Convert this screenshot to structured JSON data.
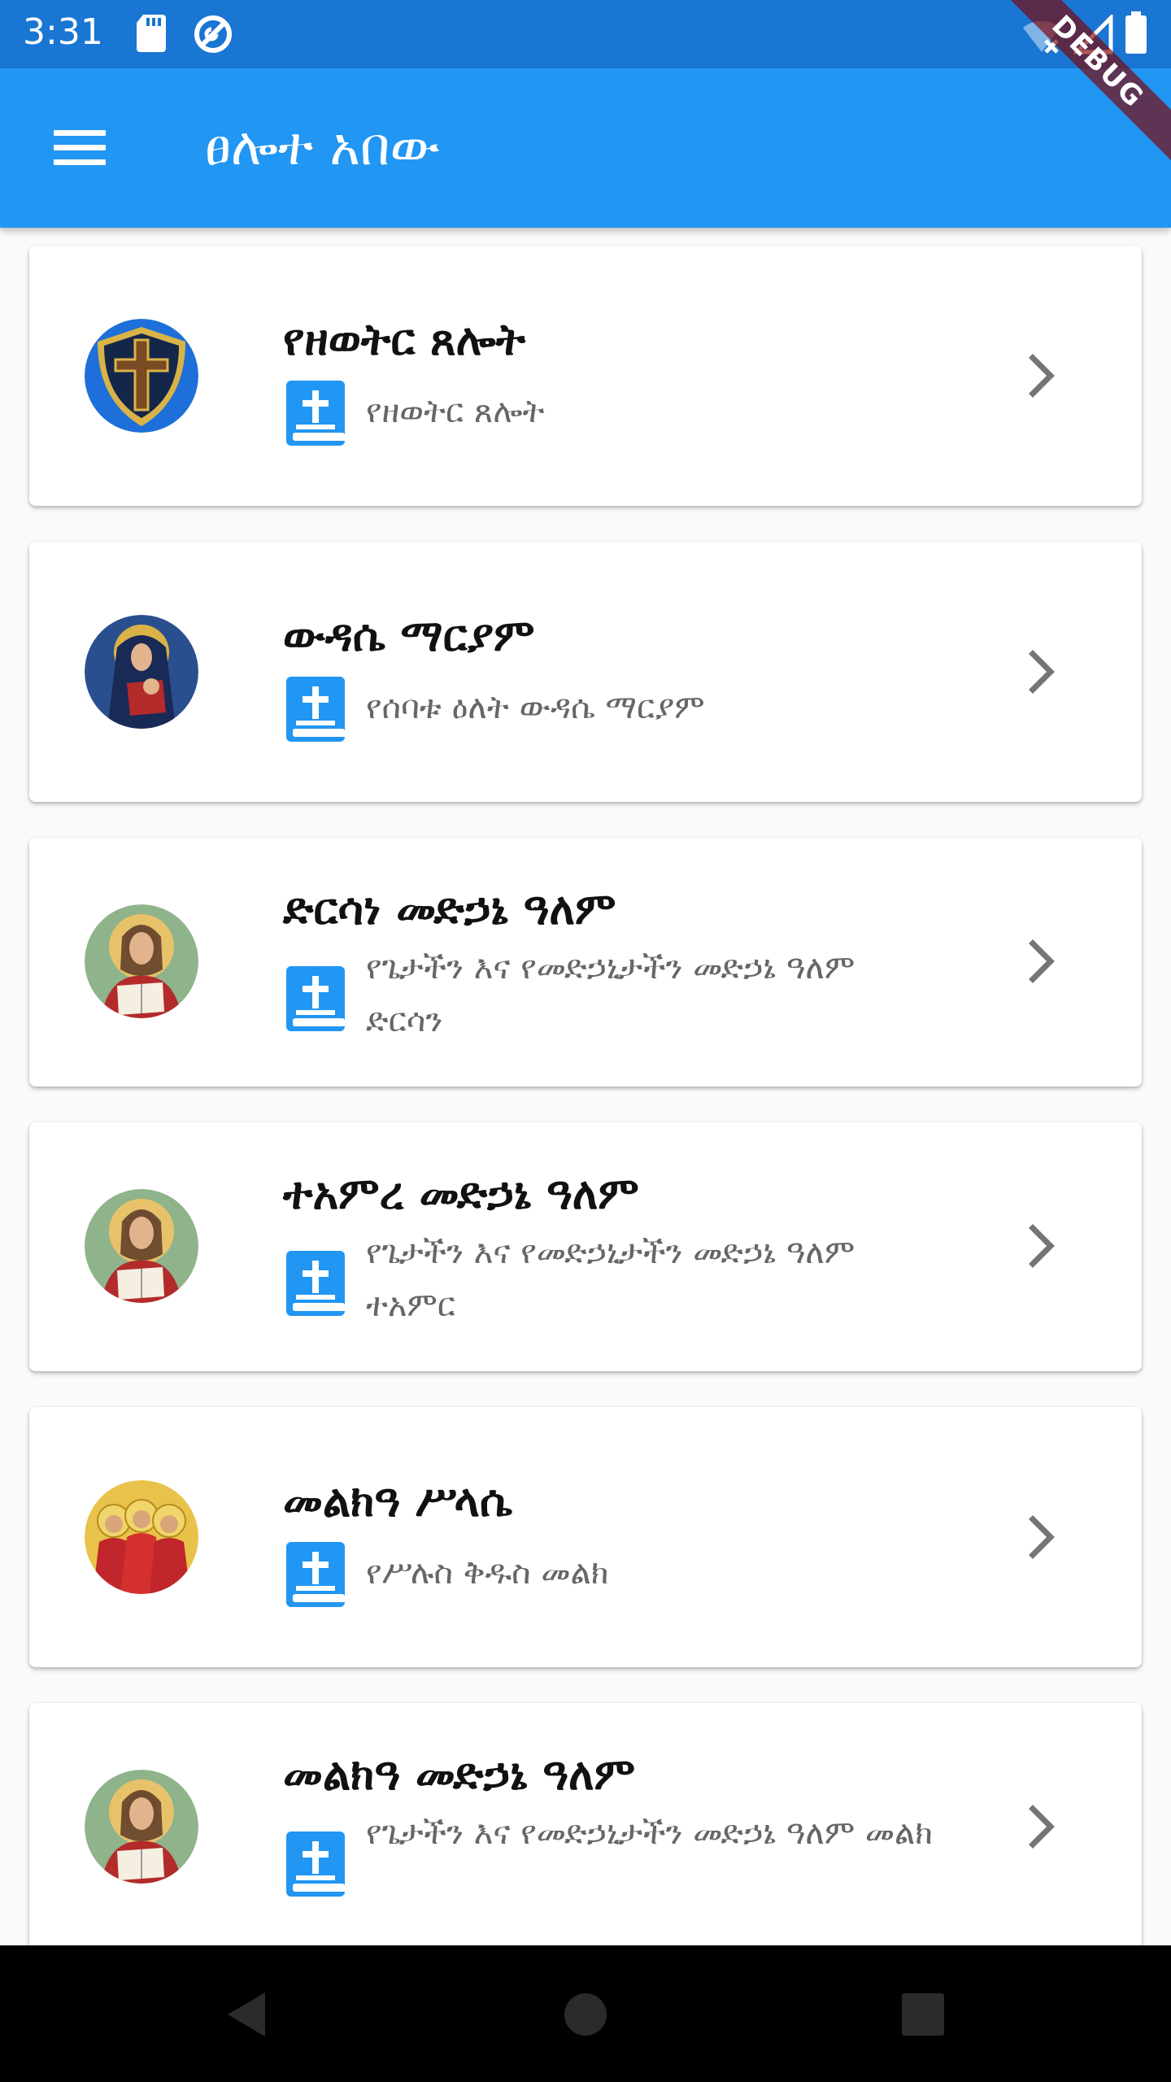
{
  "status_bar": {
    "time": "3:31",
    "icons": [
      "sd-card-icon",
      "sync-icon",
      "wifi-off-icon",
      "signal-icon",
      "battery-icon"
    ]
  },
  "debug_banner": "DEBUG",
  "app_bar": {
    "title": "ፀሎተ አበው",
    "menu_icon": "menu-icon",
    "color": "#2196f3",
    "status_color": "#1976d2"
  },
  "list": {
    "items": [
      {
        "title": "የዘወትር ጸሎት",
        "subtitle": "የዘወትር ጸሎት",
        "avatar": "cross-shield"
      },
      {
        "title": "ውዳሴ ማርያም",
        "subtitle": "የሰባቱ ዕለት ውዳሴ ማርያም",
        "avatar": "mary-icon"
      },
      {
        "title": "ድርሳነ መድኃኔ ዓለም",
        "subtitle": "የጌታችን እና የመድኃኒታችን መድኃኔ ዓለም ድርሳን",
        "avatar": "christ-icon"
      },
      {
        "title": "ተአምረ መድኃኔ ዓለም",
        "subtitle": "የጌታችን እና የመድኃኒታችን መድኃኔ ዓለም ተአምር",
        "avatar": "christ-icon"
      },
      {
        "title": "መልክዓ ሥላሴ",
        "subtitle": "የሥሉስ ቅዱስ መልክ",
        "avatar": "trinity-icon"
      },
      {
        "title": "መልክዓ መድኃኔ ዓለም",
        "subtitle": "የጌታችን እና የመድኃኒታችን መድኃኔ ዓለም መልክ",
        "avatar": "christ-icon"
      }
    ],
    "item_icon": "bible-book-icon",
    "trailing_icon": "chevron-right-icon",
    "accent": "#2196f3"
  },
  "nav_bar": {
    "buttons": [
      "back-icon",
      "home-icon",
      "recents-icon"
    ]
  }
}
